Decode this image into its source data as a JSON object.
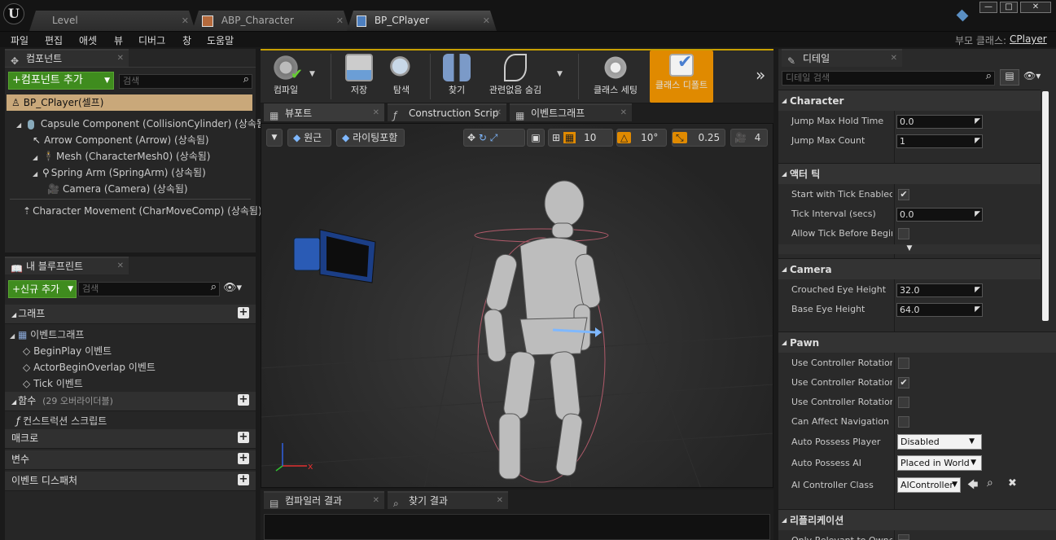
{
  "titlebar": {
    "tabs": [
      {
        "label": "Level"
      },
      {
        "label": "ABP_Character"
      },
      {
        "label": "BP_CPlayer"
      }
    ]
  },
  "menubar": {
    "items": [
      "파일",
      "편집",
      "애셋",
      "뷰",
      "디버그",
      "창",
      "도움말"
    ],
    "parent_class_label": "부모 클래스:",
    "parent_class_value": "CPlayer"
  },
  "components_panel": {
    "tab_label": "컴포넌트",
    "add_button": "+컴포넌트 추가",
    "search_placeholder": "검색",
    "self_item": "BP_CPlayer(셀프)",
    "tree": [
      {
        "label": "Capsule Component (CollisionCylinder) (상속됨)"
      },
      {
        "label": "Arrow Component (Arrow) (상속됨)"
      },
      {
        "label": "Mesh (CharacterMesh0) (상속됨)"
      },
      {
        "label": "Spring Arm (SpringArm) (상속됨)"
      },
      {
        "label": "Camera (Camera) (상속됨)"
      },
      {
        "label": "Character Movement (CharMoveComp) (상속됨)"
      }
    ]
  },
  "my_blueprint": {
    "tab_label": "내 블루프린트",
    "new_button": "+신규 추가",
    "search_placeholder": "검색",
    "graph_section": "그래프",
    "event_graph": "이벤트그래프",
    "events": [
      "BeginPlay 이벤트",
      "ActorBeginOverlap 이벤트",
      "Tick 이벤트"
    ],
    "functions_section": "함수",
    "functions_note": "(29 오버라이더블)",
    "construction_script": "컨스트럭션 스크립트",
    "macros_section": "매크로",
    "variables_section": "변수",
    "dispatchers_section": "이벤트 디스패처"
  },
  "toolbar": {
    "buttons": [
      {
        "label": "컴파일"
      },
      {
        "label": "저장"
      },
      {
        "label": "탐색"
      },
      {
        "label": "찾기"
      },
      {
        "label": "관련없음 숨김"
      },
      {
        "label": "클래스 세팅"
      },
      {
        "label": "클래스 디폴트"
      }
    ]
  },
  "editor_tabs": [
    {
      "label": "뷰포트"
    },
    {
      "label": "Construction Scrip"
    },
    {
      "label": "이벤트그래프"
    }
  ],
  "viewport": {
    "perspective_label": "원근",
    "lighting_label": "라이팅포함",
    "grid_snap": "10",
    "rotation_snap": "10°",
    "scale_snap": "0.25",
    "camera_speed": "4"
  },
  "bottom_tabs": [
    {
      "label": "컴파일러 결과"
    },
    {
      "label": "찾기 결과"
    }
  ],
  "details": {
    "tab_label": "디테일",
    "search_placeholder": "디테일 검색",
    "sections": {
      "character": "Character",
      "actor_tick": "액터 틱",
      "camera": "Camera",
      "pawn": "Pawn",
      "replication": "리플리케이션"
    },
    "character_rows": [
      {
        "label": "Jump Max Hold Time",
        "value": "0.0"
      },
      {
        "label": "Jump Max Count",
        "value": "1"
      }
    ],
    "tick_rows": {
      "start_with_tick": "Start with Tick Enabled",
      "tick_interval": "Tick Interval (secs)",
      "tick_interval_value": "0.0",
      "allow_tick": "Allow Tick Before Begin Play"
    },
    "camera_rows": [
      {
        "label": "Crouched Eye Height",
        "value": "32.0"
      },
      {
        "label": "Base Eye Height",
        "value": "64.0"
      }
    ],
    "pawn_rows": {
      "ucr_pitch": "Use Controller Rotation Pitch",
      "ucr_yaw": "Use Controller Rotation Yaw",
      "ucr_roll": "Use Controller Rotation Roll",
      "can_affect_nav": "Can Affect Navigation Generation",
      "auto_possess_player": "Auto Possess Player",
      "auto_possess_player_value": "Disabled",
      "auto_possess_ai": "Auto Possess AI",
      "auto_possess_ai_value": "Placed in World",
      "ai_controller_class": "AI Controller Class",
      "ai_controller_class_value": "AIController"
    },
    "replication_rows": {
      "only_relevant": "Only Relevant to Owner"
    }
  },
  "colors": {
    "accent_green": "#3f8c1e",
    "accent_orange": "#e08a00",
    "self_item_bg": "#c9a87a"
  }
}
